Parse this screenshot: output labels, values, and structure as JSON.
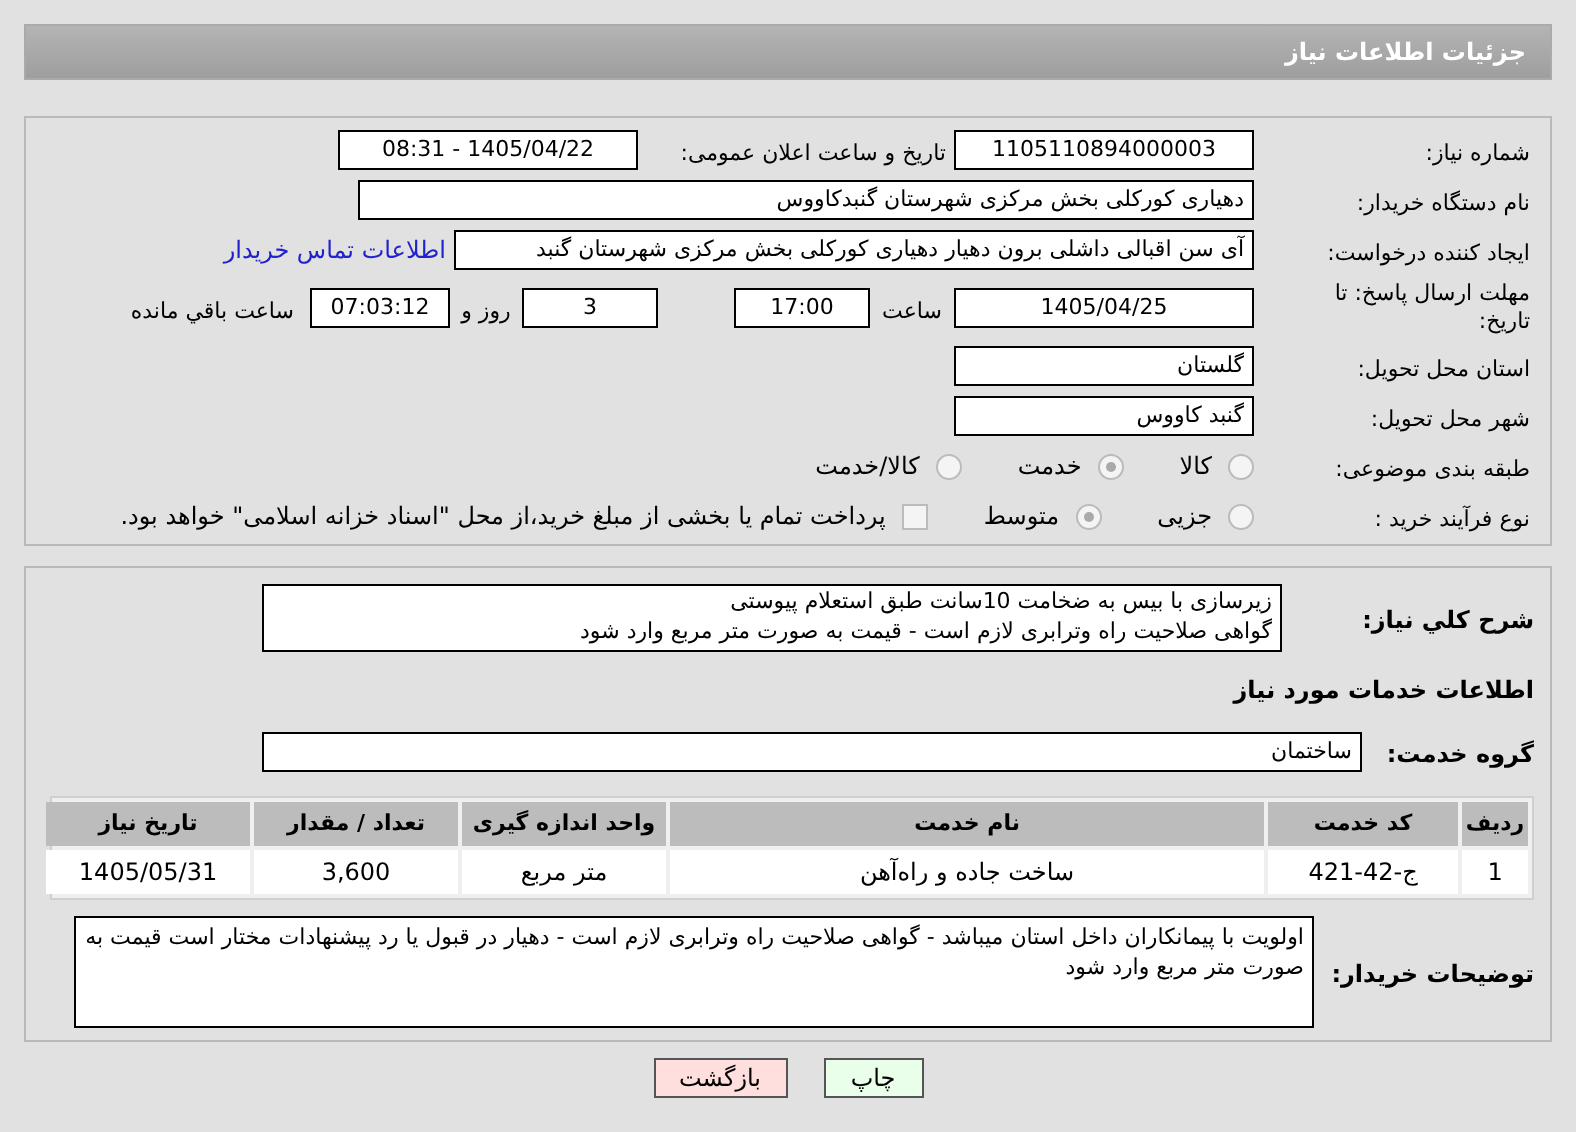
{
  "header": {
    "title": "جزئیات اطلاعات نیاز"
  },
  "need_number": {
    "label": "شماره نیاز:",
    "value": "1105110894000003"
  },
  "announce": {
    "label": "تاریخ و ساعت اعلان عمومی:",
    "value": "1405/04/22 - 08:31"
  },
  "buyer_org": {
    "label": "نام دستگاه خریدار:",
    "value": "دهیاری کورکلی بخش مرکزی شهرستان گنبدکاووس"
  },
  "requester": {
    "label": "ایجاد کننده درخواست:",
    "value": "آی سن اقبالی داشلی برون دهیار دهیاری کورکلی بخش مرکزی شهرستان گنبد",
    "link": "اطلاعات تماس خریدار"
  },
  "deadline": {
    "label": "مهلت ارسال پاسخ: تا تاریخ:",
    "date": "1405/04/25",
    "time_label": "ساعت",
    "time": "17:00",
    "days": "3",
    "days_label": "روز و",
    "remaining": "07:03:12",
    "remaining_label": "ساعت باقي مانده"
  },
  "province": {
    "label": "استان محل تحویل:",
    "value": "گلستان"
  },
  "city": {
    "label": "شهر محل تحویل:",
    "value": "گنبد کاووس"
  },
  "category": {
    "label": "طبقه بندی موضوعی:",
    "options": [
      {
        "label": "کالا",
        "selected": false
      },
      {
        "label": "خدمت",
        "selected": true
      },
      {
        "label": "کالا/خدمت",
        "selected": false
      }
    ]
  },
  "purchase_type": {
    "label": "نوع فرآیند خرید :",
    "options": [
      {
        "label": "جزیی",
        "selected": false
      },
      {
        "label": "متوسط",
        "selected": true
      }
    ],
    "treasury": {
      "checked": false,
      "text": "پرداخت تمام یا بخشی از مبلغ خرید،از محل \"اسناد خزانه اسلامی\" خواهد بود."
    }
  },
  "description": {
    "label": "شرح کلي نیاز:",
    "value": "زیرسازی با بیس به ضخامت 10سانت طبق استعلام پیوستی\nگواهی صلاحیت راه وترابری لازم است - قیمت به صورت متر مربع وارد شود"
  },
  "services": {
    "heading": "اطلاعات خدمات مورد نیاز",
    "group_label": "گروه خدمت:",
    "group": "ساختمان",
    "table": {
      "columns": [
        "ردیف",
        "کد خدمت",
        "نام خدمت",
        "واحد اندازه گیری",
        "تعداد / مقدار",
        "تاریخ نیاز"
      ],
      "rows": [
        [
          "1",
          "ج-42-421",
          "ساخت جاده و راه‌آهن",
          "متر مربع",
          "3,600",
          "1405/05/31"
        ]
      ]
    }
  },
  "buyer_notes": {
    "label": "توضیحات خریدار:",
    "value": "اولویت با پیمانکاران داخل استان میباشد - گواهی صلاحیت راه وترابری لازم است - دهیار در قبول یا رد پیشنهادات مختار است قیمت به صورت متر مربع وارد شود"
  },
  "buttons": [
    {
      "label": "چاپ",
      "kind": "print"
    },
    {
      "label": "بازگشت",
      "kind": "back"
    }
  ]
}
